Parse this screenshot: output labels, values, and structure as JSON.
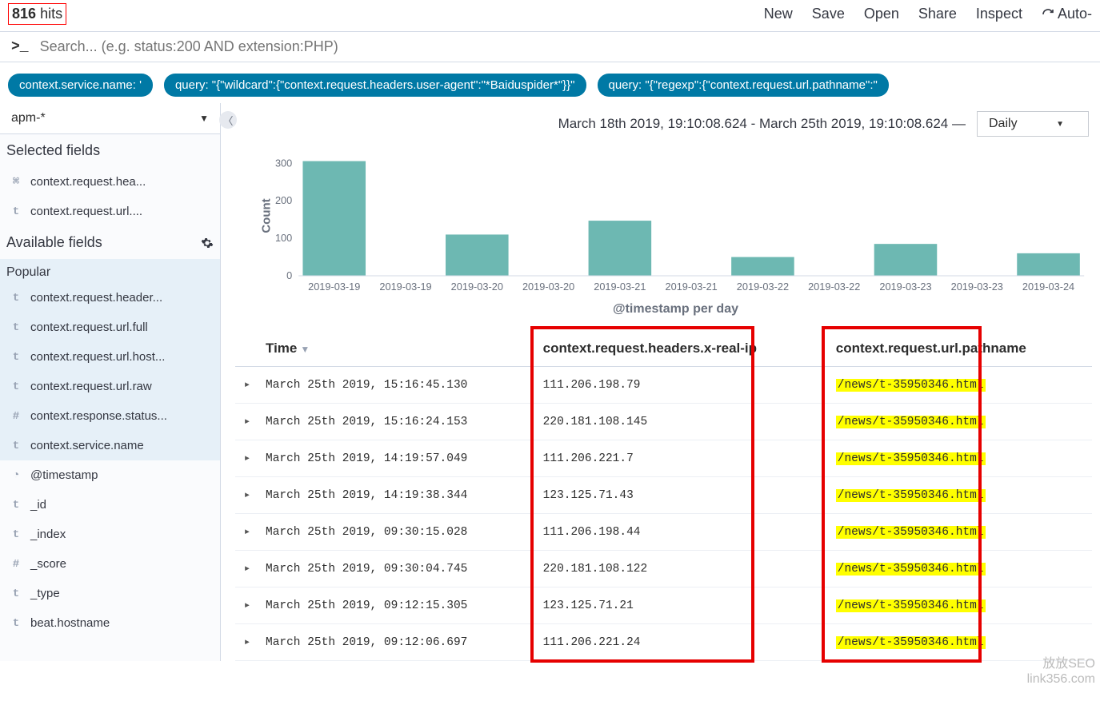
{
  "hits": {
    "count": "816",
    "label": "hits"
  },
  "topbar": {
    "new": "New",
    "save": "Save",
    "open": "Open",
    "share": "Share",
    "inspect": "Inspect",
    "auto": "Auto-"
  },
  "search": {
    "prompt": ">_",
    "placeholder": "Search... (e.g. status:200 AND extension:PHP)"
  },
  "filters": [
    "context.service.name: '",
    "query: \"{\"wildcard\":{\"context.request.headers.user-agent\":\"*Baiduspider*\"}}\"",
    "query: \"{\"regexp\":{\"context.request.url.pathname\":\""
  ],
  "index_pattern": "apm-*",
  "sidebar": {
    "selected_hdr": "Selected fields",
    "available_hdr": "Available fields",
    "popular_hdr": "Popular",
    "selected": [
      {
        "icon": "laptop",
        "label": "context.request.hea..."
      },
      {
        "icon": "t",
        "label": "context.request.url...."
      }
    ],
    "popular": [
      {
        "icon": "t",
        "label": "context.request.header..."
      },
      {
        "icon": "t",
        "label": "context.request.url.full"
      },
      {
        "icon": "t",
        "label": "context.request.url.host..."
      },
      {
        "icon": "t",
        "label": "context.request.url.raw"
      },
      {
        "icon": "#",
        "label": "context.response.status..."
      },
      {
        "icon": "t",
        "label": "context.service.name"
      }
    ],
    "available": [
      {
        "icon": "clock",
        "label": "@timestamp"
      },
      {
        "icon": "t",
        "label": "_id"
      },
      {
        "icon": "t",
        "label": "_index"
      },
      {
        "icon": "#",
        "label": "_score"
      },
      {
        "icon": "t",
        "label": "_type"
      },
      {
        "icon": "t",
        "label": "beat.hostname"
      }
    ]
  },
  "time": {
    "range": "March 18th 2019, 19:10:08.624 - March 25th 2019, 19:10:08.624 —",
    "interval": "Daily"
  },
  "chart_data": {
    "type": "bar",
    "categories": [
      "2019-03-19",
      "2019-03-19",
      "2019-03-20",
      "2019-03-20",
      "2019-03-21",
      "2019-03-21",
      "2019-03-22",
      "2019-03-22",
      "2019-03-23",
      "2019-03-23",
      "2019-03-24"
    ],
    "values": [
      306,
      0,
      110,
      0,
      147,
      0,
      50,
      0,
      85,
      0,
      60
    ],
    "ylabel": "Count",
    "xlabel": "@timestamp per day",
    "yticks": [
      0,
      100,
      200,
      300
    ],
    "ylim": [
      0,
      320
    ]
  },
  "table": {
    "cols": [
      "Time",
      "context.request.headers.x-real-ip",
      "context.request.url.pathname"
    ],
    "rows": [
      {
        "time": "March 25th 2019, 15:16:45.130",
        "ip": "111.206.198.79",
        "path": "/news/t-35950346.html"
      },
      {
        "time": "March 25th 2019, 15:16:24.153",
        "ip": "220.181.108.145",
        "path": "/news/t-35950346.html"
      },
      {
        "time": "March 25th 2019, 14:19:57.049",
        "ip": "111.206.221.7",
        "path": "/news/t-35950346.html"
      },
      {
        "time": "March 25th 2019, 14:19:38.344",
        "ip": "123.125.71.43",
        "path": "/news/t-35950346.html"
      },
      {
        "time": "March 25th 2019, 09:30:15.028",
        "ip": "111.206.198.44",
        "path": "/news/t-35950346.html"
      },
      {
        "time": "March 25th 2019, 09:30:04.745",
        "ip": "220.181.108.122",
        "path": "/news/t-35950346.html"
      },
      {
        "time": "March 25th 2019, 09:12:15.305",
        "ip": "123.125.71.21",
        "path": "/news/t-35950346.html"
      },
      {
        "time": "March 25th 2019, 09:12:06.697",
        "ip": "111.206.221.24",
        "path": "/news/t-35950346.html"
      }
    ]
  },
  "watermark": {
    "line1": "放放SEO",
    "line2": "link356.com"
  }
}
